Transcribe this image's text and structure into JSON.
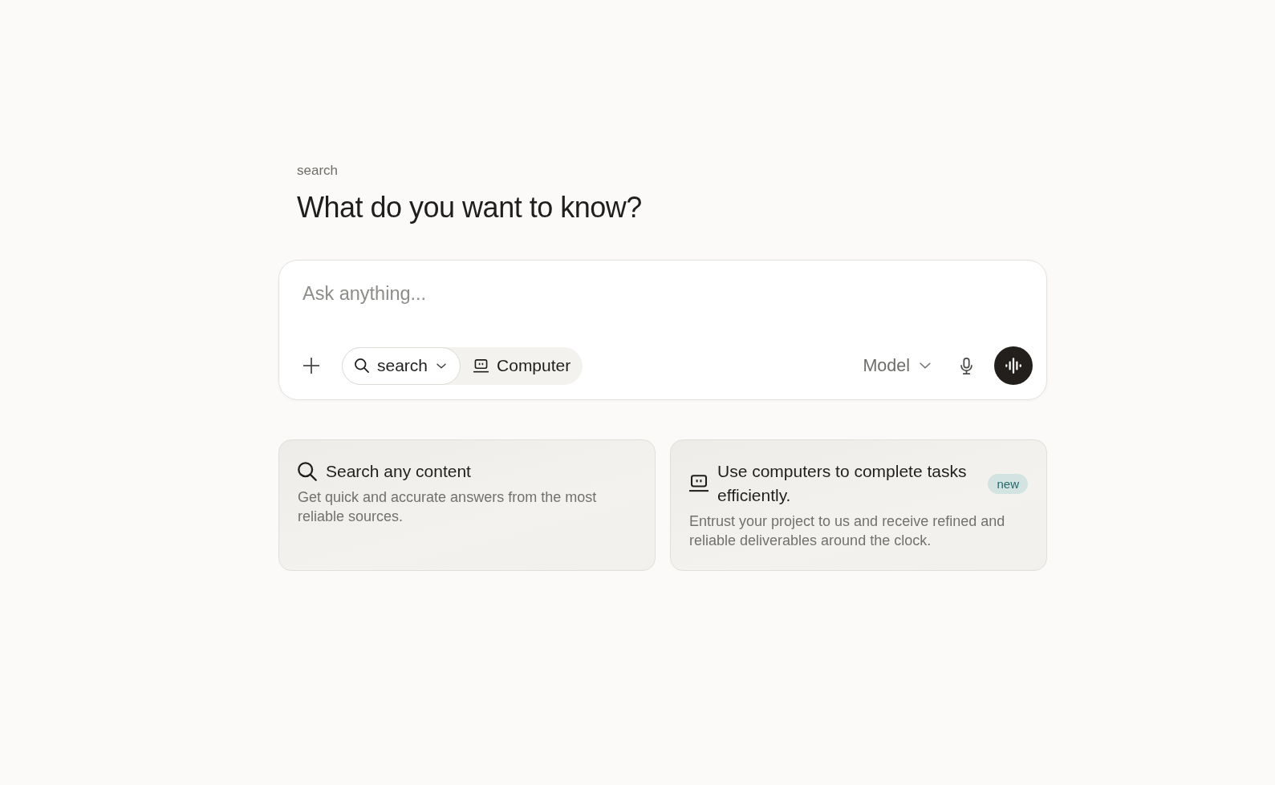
{
  "breadcrumb": "search",
  "heading": "What do you want to know?",
  "composer": {
    "placeholder": "Ask anything...",
    "modes": [
      {
        "kind": "search",
        "label": "search",
        "selected": true,
        "menu": true
      },
      {
        "kind": "computer",
        "label": "Computer",
        "selected": false,
        "menu": false
      }
    ],
    "model": "Model"
  },
  "cards": [
    {
      "kind": "search",
      "title": "Search any content",
      "description": "Get quick and accurate answers from the most reliable sources."
    },
    {
      "kind": "computer",
      "title": "Use computers to complete tasks efficiently.",
      "description": "Entrust your project to us and receive refined and reliable deliverables around the clock.",
      "badge": "new"
    }
  ]
}
